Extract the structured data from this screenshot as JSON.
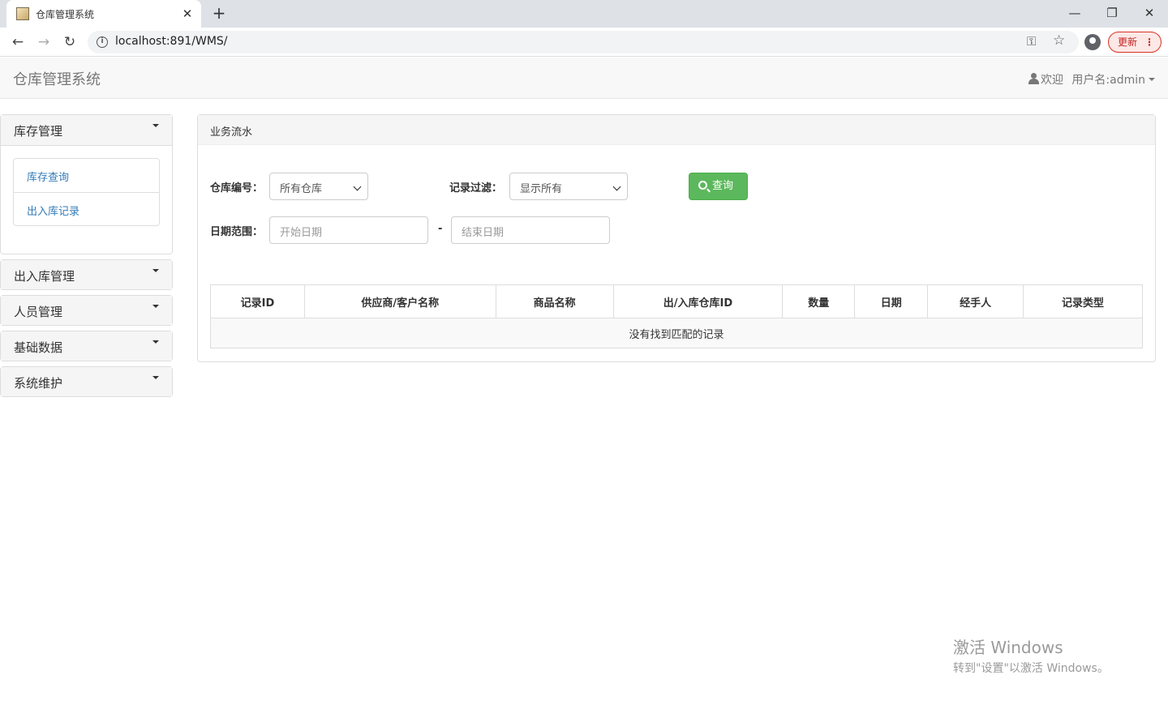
{
  "browser": {
    "tab_title": "仓库管理系统",
    "url": "localhost:891/WMS/",
    "update_label": "更新"
  },
  "navbar": {
    "brand": "仓库管理系统",
    "welcome": "欢迎",
    "username": "用户名:admin"
  },
  "sidebar": {
    "panels": [
      {
        "title": "库存管理",
        "expanded": true,
        "items": [
          "库存查询",
          "出入库记录"
        ]
      },
      {
        "title": "出入库管理"
      },
      {
        "title": "人员管理"
      },
      {
        "title": "基础数据"
      },
      {
        "title": "系统维护"
      }
    ]
  },
  "main": {
    "panel_title": "业务流水",
    "filters": {
      "warehouse_label": "仓库编号：",
      "warehouse_value": "所有仓库",
      "record_filter_label": "记录过滤：",
      "record_filter_value": "显示所有",
      "date_range_label": "日期范围：",
      "start_date_placeholder": "开始日期",
      "end_date_placeholder": "结束日期",
      "range_separator": "-",
      "query_button": "查询"
    },
    "table": {
      "columns": [
        "记录ID",
        "供应商/客户名称",
        "商品名称",
        "出/入库仓库ID",
        "数量",
        "日期",
        "经手人",
        "记录类型"
      ],
      "empty_message": "没有找到匹配的记录"
    }
  },
  "watermark": {
    "line1": "激活 Windows",
    "line2": "转到\"设置\"以激活 Windows。"
  }
}
